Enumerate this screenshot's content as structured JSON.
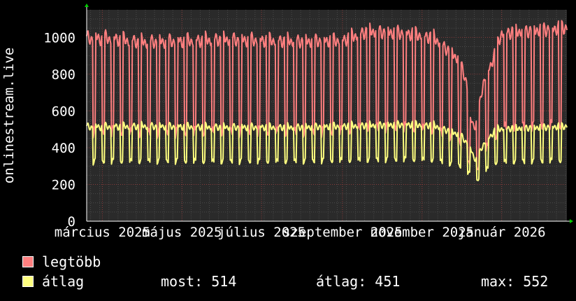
{
  "chart_data": {
    "type": "line",
    "ylabel": "onlinestream.live",
    "xlabel": "",
    "ylim": [
      0,
      1150
    ],
    "yticks": [
      0,
      200,
      400,
      600,
      800,
      1000
    ],
    "xlim": [
      "2025-02-17",
      "2026-02-20"
    ],
    "x_tick_labels": [
      {
        "date": "2025-03-01",
        "label": "március 2025"
      },
      {
        "date": "2025-05-01",
        "label": "május 2025"
      },
      {
        "date": "2025-07-01",
        "label": "július 2025"
      },
      {
        "date": "2025-09-01",
        "label": "szeptember 2025"
      },
      {
        "date": "2025-11-01",
        "label": "november 2025"
      },
      {
        "date": "2026-01-01",
        "label": "január 2026"
      }
    ],
    "grid": true,
    "series": [
      {
        "name": "legtöbb",
        "color": "#ff7f7f",
        "points": [
          {
            "x": "2025-02-17",
            "y": 1000
          },
          {
            "x": "2025-03-06",
            "y": 1000
          },
          {
            "x": "2025-04-01",
            "y": 980
          },
          {
            "x": "2025-05-01",
            "y": 985
          },
          {
            "x": "2025-06-01",
            "y": 995
          },
          {
            "x": "2025-07-01",
            "y": 990
          },
          {
            "x": "2025-08-01",
            "y": 985
          },
          {
            "x": "2025-09-01",
            "y": 990
          },
          {
            "x": "2025-09-20",
            "y": 1040
          },
          {
            "x": "2025-10-20",
            "y": 1030
          },
          {
            "x": "2025-11-10",
            "y": 1005
          },
          {
            "x": "2025-11-30",
            "y": 880
          },
          {
            "x": "2025-12-05",
            "y": 760
          },
          {
            "x": "2025-12-08",
            "y": 560
          },
          {
            "x": "2025-12-12",
            "y": 510
          },
          {
            "x": "2025-12-18",
            "y": 760
          },
          {
            "x": "2025-12-24",
            "y": 860
          },
          {
            "x": "2026-01-01",
            "y": 1030
          },
          {
            "x": "2026-02-20",
            "y": 1060
          }
        ]
      },
      {
        "name": "átlag",
        "color": "#ffff80",
        "points": [
          {
            "x": "2025-02-17",
            "y": 515
          },
          {
            "x": "2025-04-01",
            "y": 520
          },
          {
            "x": "2025-06-01",
            "y": 515
          },
          {
            "x": "2025-08-01",
            "y": 515
          },
          {
            "x": "2025-09-20",
            "y": 525
          },
          {
            "x": "2025-10-20",
            "y": 530
          },
          {
            "x": "2025-11-10",
            "y": 525
          },
          {
            "x": "2025-12-01",
            "y": 470
          },
          {
            "x": "2025-12-08",
            "y": 400
          },
          {
            "x": "2025-12-12",
            "y": 330
          },
          {
            "x": "2025-12-18",
            "y": 420
          },
          {
            "x": "2025-12-28",
            "y": 505
          },
          {
            "x": "2026-02-20",
            "y": 520
          }
        ]
      }
    ],
    "stats": {
      "most": "most: 514",
      "atlag": "átlag: 451",
      "max": "max: 552"
    }
  }
}
